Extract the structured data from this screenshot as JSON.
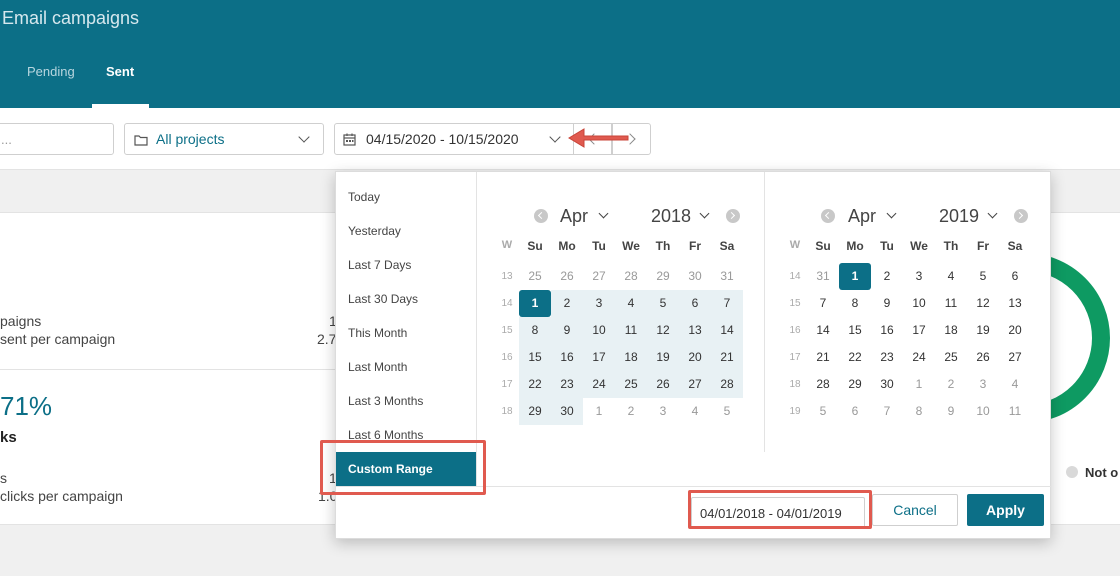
{
  "header": {
    "title": "Email campaigns",
    "tabs": [
      "Pending",
      "Sent"
    ]
  },
  "filters": {
    "search_placeholder": "...",
    "project": "All projects",
    "date_range": "04/15/2020 - 10/15/2020"
  },
  "stats": {
    "line1": "paigns",
    "line2": "sent per campaign",
    "val1": "1",
    "val2": "2.7",
    "pct": "71%",
    "bold": "ks",
    "line3": "s",
    "line4": "clicks per campaign",
    "val3": "1",
    "val4": "1.0",
    "legend_label": "Not o"
  },
  "picker": {
    "ranges": [
      "Today",
      "Yesterday",
      "Last 7 Days",
      "Last 30 Days",
      "This Month",
      "Last Month",
      "Last 3 Months",
      "Last 6 Months"
    ],
    "active_range": "Custom Range",
    "weekday_headers": [
      "W",
      "Su",
      "Mo",
      "Tu",
      "We",
      "Th",
      "Fr",
      "Sa"
    ],
    "left": {
      "month": "Apr",
      "year": "2018",
      "weeks": [
        "13",
        "14",
        "15",
        "16",
        "17",
        "18"
      ],
      "rows": [
        [
          "25",
          "26",
          "27",
          "28",
          "29",
          "30",
          "31"
        ],
        [
          "1",
          "2",
          "3",
          "4",
          "5",
          "6",
          "7"
        ],
        [
          "8",
          "9",
          "10",
          "11",
          "12",
          "13",
          "14"
        ],
        [
          "15",
          "16",
          "17",
          "18",
          "19",
          "20",
          "21"
        ],
        [
          "22",
          "23",
          "24",
          "25",
          "26",
          "27",
          "28"
        ],
        [
          "29",
          "30",
          "1",
          "2",
          "3",
          "4",
          "5"
        ]
      ]
    },
    "right": {
      "month": "Apr",
      "year": "2019",
      "weeks": [
        "14",
        "15",
        "16",
        "17",
        "18",
        "19"
      ],
      "rows": [
        [
          "31",
          "1",
          "2",
          "3",
          "4",
          "5",
          "6"
        ],
        [
          "7",
          "8",
          "9",
          "10",
          "11",
          "12",
          "13"
        ],
        [
          "14",
          "15",
          "16",
          "17",
          "18",
          "19",
          "20"
        ],
        [
          "21",
          "22",
          "23",
          "24",
          "25",
          "26",
          "27"
        ],
        [
          "28",
          "29",
          "30",
          "1",
          "2",
          "3",
          "4"
        ],
        [
          "5",
          "6",
          "7",
          "8",
          "9",
          "10",
          "11"
        ]
      ]
    },
    "range_input": "04/01/2018 - 04/01/2019",
    "cancel_label": "Cancel",
    "apply_label": "Apply"
  },
  "colors": {
    "primary": "#0c6f87",
    "highlight": "#e05a4f",
    "range_bg": "#e8f1f4",
    "donut": "#0e9a62"
  }
}
